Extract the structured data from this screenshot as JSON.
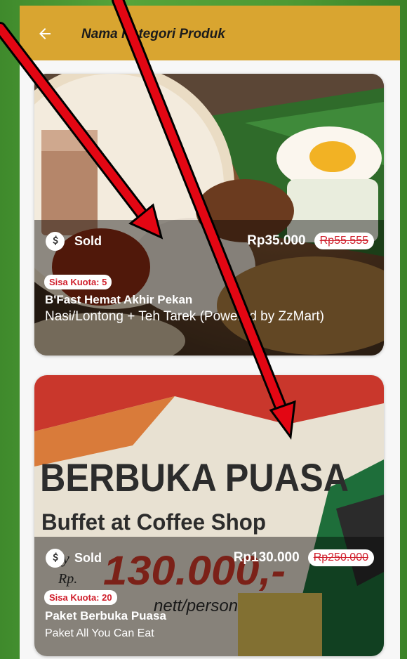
{
  "appbar": {
    "title": "Nama Kategori Produk",
    "bg_color": "#d9a530"
  },
  "cards": [
    {
      "sold_label": "Sold",
      "price": "Rp35.000",
      "old_price": "Rp55.555",
      "quota": "Sisa Kuota: 5",
      "name": "B'Fast Hemat Akhir Pekan",
      "description": "Nasi/Lontong + Teh Tarek (Powered by ZzMart)"
    },
    {
      "sold_label": "Sold",
      "price": "Rp130.000",
      "old_price": "Rp250.000",
      "quota": "Sisa Kuota: 20",
      "name": "Paket Berbuka Puasa",
      "description": "Paket All You Can Eat",
      "banner": {
        "headline": "BERBUKA PUASA",
        "subline": "Buffet at Coffee Shop",
        "promo_prefix": "Rp.",
        "promo_price": "130.000,-",
        "promo_unit": "nett/person",
        "city": "city"
      }
    }
  ],
  "colors": {
    "strike": "#d01f2c",
    "annotation_arrow": "#e30613"
  }
}
